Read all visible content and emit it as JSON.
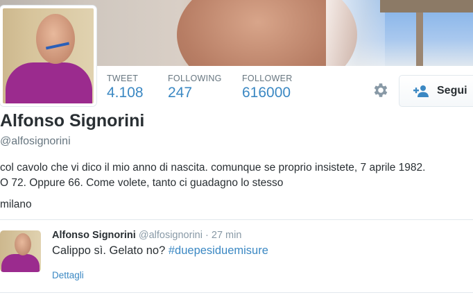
{
  "profile": {
    "name": "Alfonso Signorini",
    "handle": "@alfosignorini",
    "bio_line1": "col cavolo che vi dico il mio anno di nascita. comunque se proprio insistete, 7 aprile 1982.",
    "bio_line2": "O 72. Oppure 66. Come volete, tanto ci guadagno lo stesso",
    "location": "milano"
  },
  "stats": [
    {
      "label": "TWEET",
      "value": "4.108"
    },
    {
      "label": "FOLLOWING",
      "value": "247"
    },
    {
      "label": "FOLLOWER",
      "value": "616000"
    }
  ],
  "actions": {
    "settings_icon": "gear-icon",
    "follow_label": "Segui",
    "follow_icon": "add-user-icon"
  },
  "tweet": {
    "author_name": "Alfonso Signorini",
    "author_handle": "@alfosignorini",
    "separator": "·",
    "time": "27 min",
    "text": "Calippo sì. Gelato no?",
    "hashtag": "#duepesiduemisure",
    "details_label": "Dettagli"
  },
  "colors": {
    "link": "#3b88c3",
    "muted": "#66757f",
    "text": "#292f33",
    "shirt": "#9b2b8e"
  }
}
